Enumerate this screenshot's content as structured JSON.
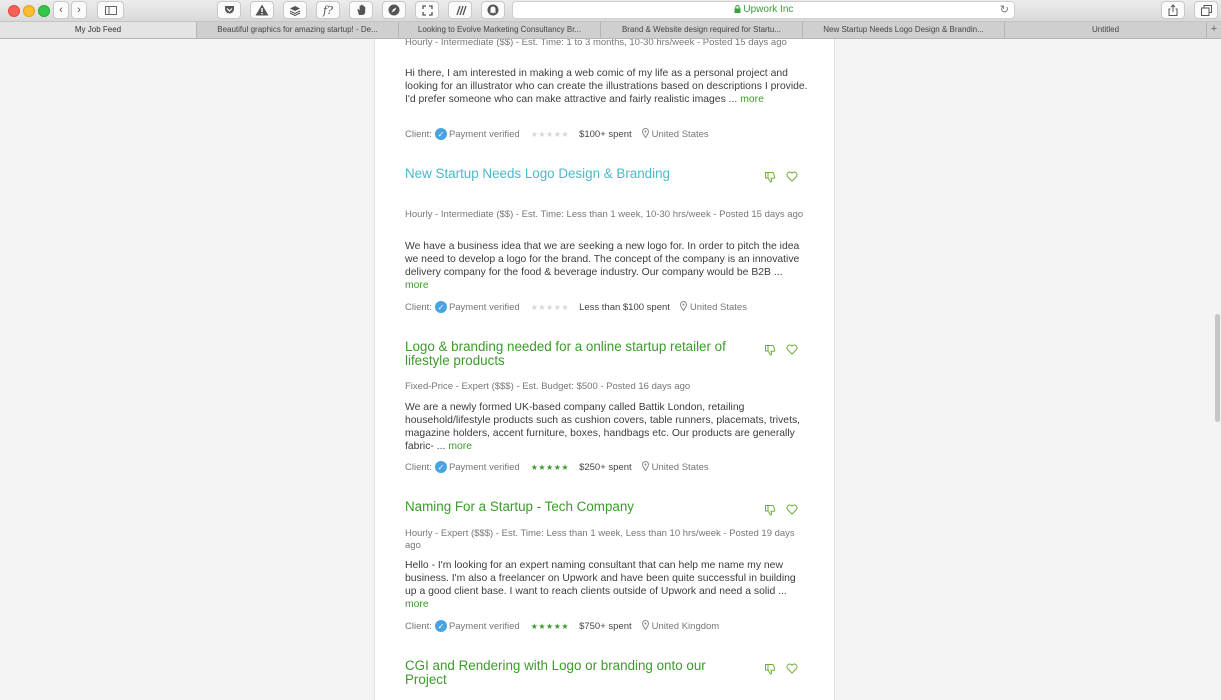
{
  "browser": {
    "address": "Upwork Inc",
    "lock_icon": "lock-icon",
    "tabs": [
      {
        "label": "My Job Feed"
      },
      {
        "label": "Beautiful graphics for amazing startup! - De..."
      },
      {
        "label": "Looking to Evolve Marketing Consultancy Br..."
      },
      {
        "label": "Brand & Website design required for Startu..."
      },
      {
        "label": "New Startup Needs Logo Design & Brandin..."
      },
      {
        "label": "Untitled"
      }
    ],
    "new_tab": "+",
    "toolbar_icons": [
      "back-icon",
      "forward-icon",
      "sidebar-icon",
      "pocket-icon",
      "warning-icon",
      "layers-icon",
      "script-icon",
      "hand-icon",
      "compass-icon",
      "resize-icon",
      "slashes-icon",
      "ghostery-icon",
      "share-icon",
      "tabs-overview-icon"
    ]
  },
  "job_partial": {
    "meta": "Hourly - Intermediate ($$) - Est. Time: 1 to 3 months, 10-30 hrs/week - Posted 15 days ago",
    "description": "Hi there, I am interested in making a web comic of my life as a personal project and looking for an illustrator who can create the illustrations based on descriptions I provide. I'd prefer someone who can make attractive and fairly realistic images ...",
    "more": "more",
    "client_label": "Client:",
    "payment": "Payment verified",
    "stars": "★★★★★",
    "rating": 0,
    "spent": "$100+ spent",
    "location": "United States"
  },
  "jobs": [
    {
      "title": "New Startup Needs Logo Design & Branding",
      "meta": "Hourly - Intermediate ($$) - Est. Time: Less than 1 week, 10-30 hrs/week - Posted 15 days ago",
      "description": "We have a business idea that we are seeking a new logo for. In order to pitch the idea we need to develop a logo for the brand. The concept of the company is an innovative delivery company for the food & beverage industry. Our company would be B2B ...",
      "more": "more",
      "client_label": "Client:",
      "payment": "Payment verified",
      "stars": "★★★★★",
      "rating": 0,
      "spent": "Less than $100 spent",
      "location": "United States"
    },
    {
      "title": "Logo & branding needed for a online startup retailer of lifestyle products",
      "meta": "Fixed-Price - Expert ($$$) - Est. Budget: $500 - Posted 16 days ago",
      "description": "We are a newly formed UK-based company called Battik London, retailing household/lifestyle products such as cushion covers, table runners, placemats, trivets, magazine holders, accent furniture, boxes, handbags etc. Our products are generally fabric- ...",
      "more": "more",
      "client_label": "Client:",
      "payment": "Payment verified",
      "stars": "★★★★★",
      "rating": 5,
      "spent": "$250+ spent",
      "location": "United States"
    },
    {
      "title": "Naming For a Startup - Tech Company",
      "meta": "Hourly - Expert ($$$) - Est. Time: Less than 1 week, Less than 10 hrs/week - Posted 19 days ago",
      "description": "Hello - I'm looking for an expert naming consultant that can help me name my new business. I'm also a freelancer on Upwork and have been quite successful in building up a good client base. I want to reach clients outside of Upwork and need a solid ...",
      "more": "more",
      "client_label": "Client:",
      "payment": "Payment verified",
      "stars": "★★★★★",
      "rating": 5,
      "spent": "$750+ spent",
      "location": "United Kingdom"
    },
    {
      "title": "CGI and Rendering with Logo or branding onto our Project"
    }
  ],
  "colors": {
    "title_green": "#3d9a2c",
    "title_visited": "#4db8c9",
    "verified_blue": "#49a3e0"
  }
}
